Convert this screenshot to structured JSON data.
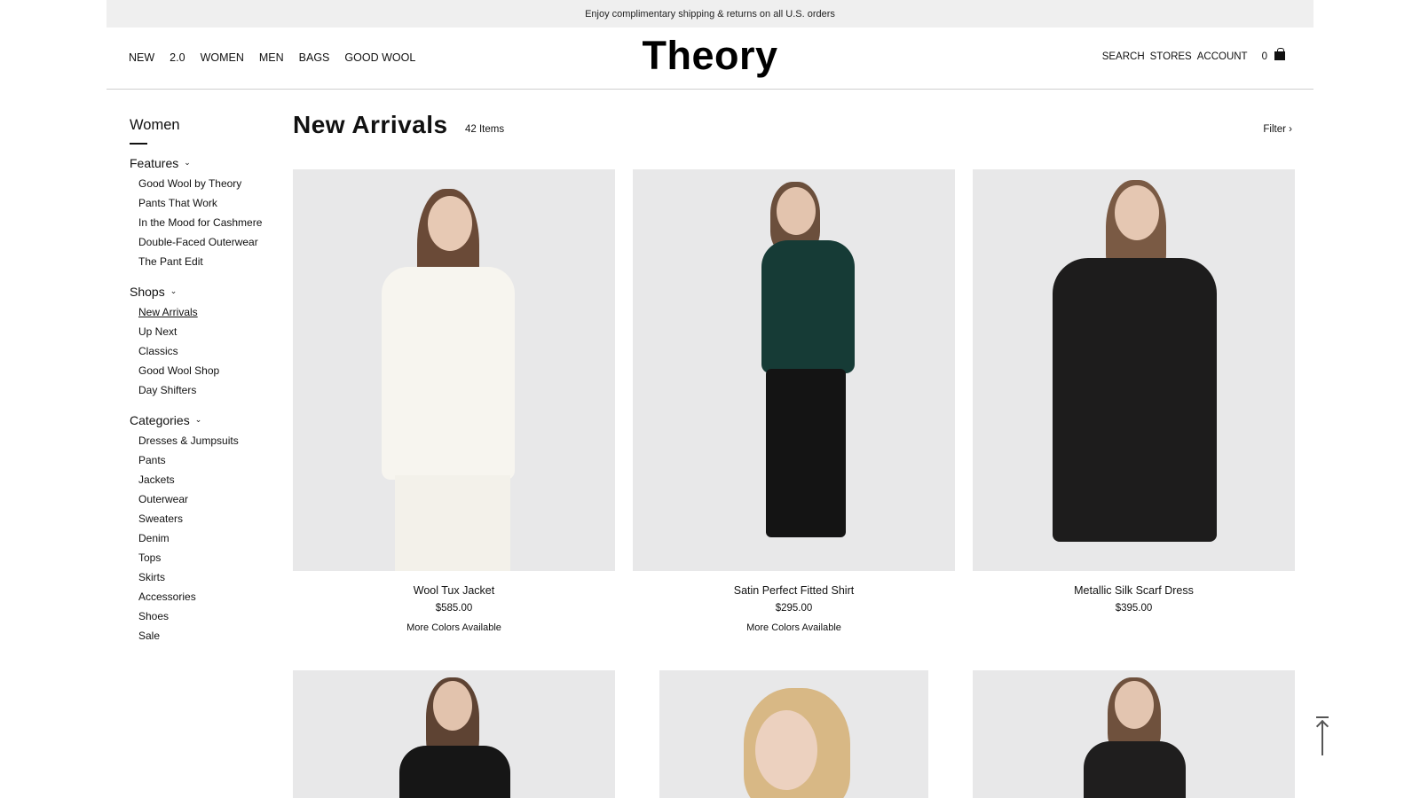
{
  "promo": {
    "text": "Enjoy complimentary shipping & returns on all U.S. orders"
  },
  "header": {
    "logo": "Theory",
    "nav": [
      "NEW",
      "2.0",
      "WOMEN",
      "MEN",
      "BAGS",
      "GOOD WOOL"
    ],
    "utility": {
      "search": "SEARCH",
      "stores": "STORES",
      "account": "ACCOUNT",
      "cart_count": "0",
      "cart_icon": "shopping-bag-icon"
    }
  },
  "sidebar": {
    "title": "Women",
    "groups": [
      {
        "label": "Features",
        "items": [
          "Good Wool by Theory",
          "Pants That Work",
          "In the Mood for Cashmere",
          "Double-Faced Outerwear",
          "The Pant Edit"
        ]
      },
      {
        "label": "Shops",
        "items": [
          "New Arrivals",
          "Up Next",
          "Classics",
          "Good Wool Shop",
          "Day Shifters"
        ],
        "active": "New Arrivals"
      },
      {
        "label": "Categories",
        "items": [
          "Dresses & Jumpsuits",
          "Pants",
          "Jackets",
          "Outerwear",
          "Sweaters",
          "Denim",
          "Tops",
          "Skirts",
          "Accessories",
          "Shoes",
          "Sale"
        ]
      }
    ]
  },
  "main": {
    "title": "New Arrivals",
    "count": "42 Items",
    "filter": "Filter ›",
    "products": [
      {
        "name": "Wool Tux Jacket",
        "price": "$585.00",
        "note": "More Colors Available"
      },
      {
        "name": "Satin Perfect Fitted Shirt",
        "price": "$295.00",
        "note": "More Colors Available"
      },
      {
        "name": "Metallic Silk Scarf Dress",
        "price": "$395.00",
        "note": ""
      }
    ]
  },
  "colors": {
    "promo_bg": "#efefef",
    "image_bg": "#e8e8e9",
    "text": "#111111"
  },
  "icons": {
    "back_to_top": "arrow-up-icon"
  }
}
